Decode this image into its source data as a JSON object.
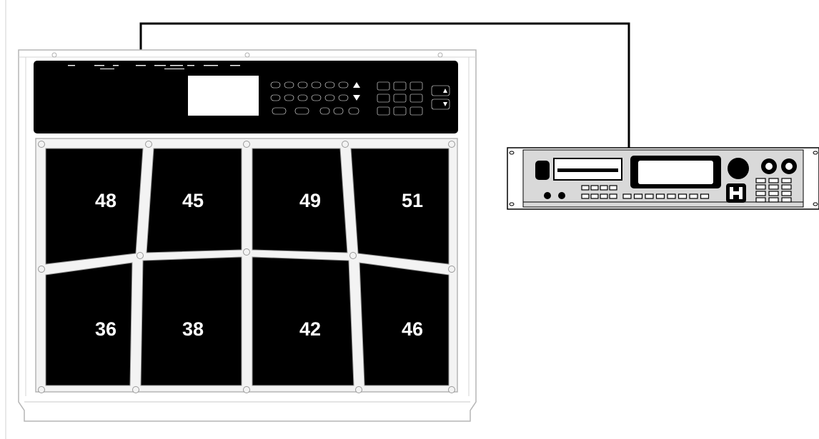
{
  "pads": {
    "top": [
      "48",
      "45",
      "49",
      "51"
    ],
    "bottom": [
      "36",
      "38",
      "42",
      "46"
    ]
  },
  "colors": {
    "pad": "#000000",
    "label": "#ffffff",
    "outline": "#999999",
    "cable": "#000000"
  },
  "icons": {
    "drum_pad_controller": "octapad-controller",
    "sound_module": "rack-sound-module",
    "cable": "midi-cable"
  }
}
